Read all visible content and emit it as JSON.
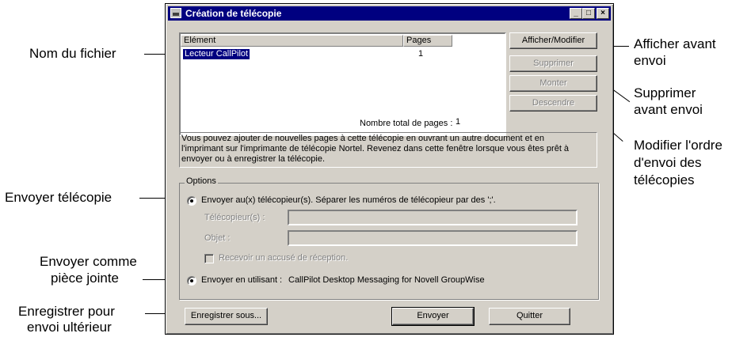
{
  "window": {
    "title": "Création de télécopie",
    "minimize": "_",
    "maximize": "□",
    "close": "×"
  },
  "list": {
    "col_element": "Elément",
    "col_pages": "Pages",
    "rows": [
      {
        "element": "Lecteur CallPilot",
        "pages": "1"
      }
    ]
  },
  "buttons": {
    "afficher_modifier": "Afficher/Modifier",
    "supprimer": "Supprimer",
    "monter": "Monter",
    "descendre": "Descendre",
    "enregistrer_sous": "Enregistrer sous...",
    "envoyer": "Envoyer",
    "quitter": "Quitter"
  },
  "total_pages": {
    "label": "Nombre total de pages :",
    "value": "1"
  },
  "info_text": "Vous pouvez ajouter de nouvelles pages à cette télécopie en ouvrant un autre document et en\nl'imprimant sur l'imprimante de télécopie Nortel. Revenez dans cette fenêtre lorsque vous êtes prêt à\nenvoyer ou à enregistrer la télécopie.",
  "options": {
    "title": "Options",
    "radio_fax": "Envoyer au(x) télécopieur(s). Séparer les numéros de télécopieur par des ';'.",
    "fax_label": "Télécopieur(s) :",
    "fax_value": "",
    "subject_label": "Objet :",
    "subject_value": "",
    "receipt_label": "Recevoir un accusé de réception.",
    "radio_attach": "Envoyer en utilisant :",
    "attach_app": "CallPilot Desktop Messaging for Novell GroupWise"
  },
  "annotations": {
    "nom_fichier": "Nom du fichier",
    "afficher_avant_1": "Afficher avant",
    "afficher_avant_2": "envoi",
    "supprimer_avant_1": "Supprimer",
    "supprimer_avant_2": "avant envoi",
    "modifier_ordre_1": "Modifier l'ordre",
    "modifier_ordre_2": "d'envoi des",
    "modifier_ordre_3": "télécopies",
    "envoyer_telecopie": "Envoyer télécopie",
    "envoyer_comme_1": "Envoyer comme",
    "envoyer_comme_2": "pièce jointe",
    "enregistrer_pour_1": "Enregistrer pour",
    "enregistrer_pour_2": "envoi ultérieur"
  }
}
